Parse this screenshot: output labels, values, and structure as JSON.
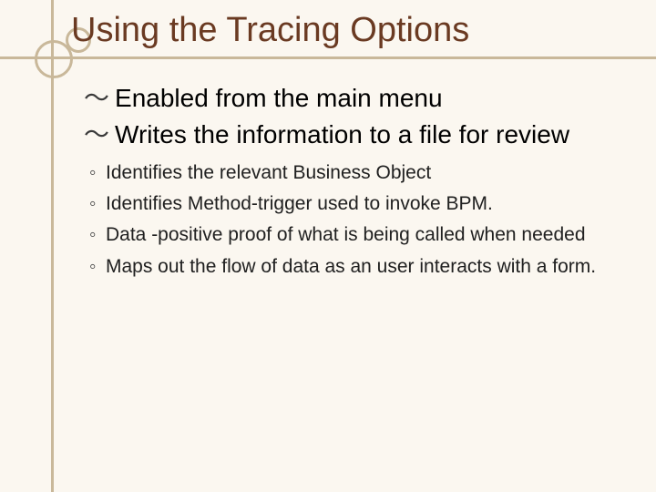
{
  "title": "Using the Tracing Options",
  "bullets": [
    {
      "lead": "Enabled",
      "rest": " from the main menu"
    },
    {
      "lead": "Writes",
      "rest": " the information to a file for review"
    }
  ],
  "sub_bullets": [
    "Identifies the relevant Business Object",
    " Identifies Method-trigger used to invoke BPM.",
    "Data -positive proof of what is being called when needed",
    "Maps out the flow of data as an user interacts with a form."
  ],
  "markers": {
    "main": "～",
    "sub": "◦"
  }
}
